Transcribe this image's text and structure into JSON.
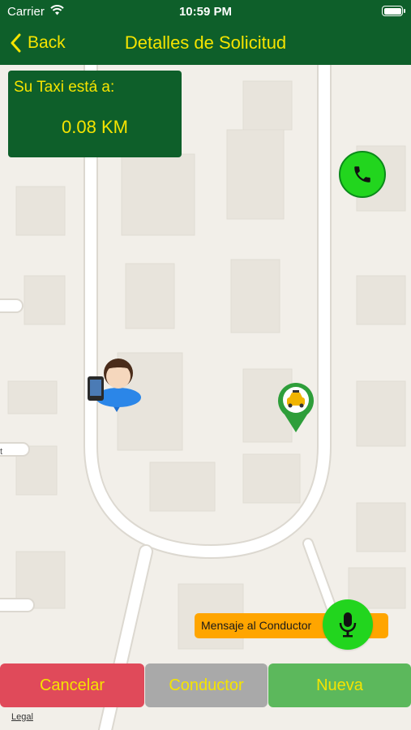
{
  "status_bar": {
    "carrier": "Carrier",
    "time": "10:59 PM"
  },
  "nav": {
    "back_label": "Back",
    "title": "Detalles de Solicitud"
  },
  "distance_card": {
    "label": "Su Taxi está a:",
    "value": "0.08 KM"
  },
  "message_bar": {
    "label": "Mensaje al Conductor"
  },
  "bottom_buttons": {
    "cancel": "Cancelar",
    "driver": "Conductor",
    "new": "Nueva"
  },
  "map": {
    "legal": "Legal",
    "street_fragment": "t"
  },
  "icons": {
    "back": "chevron-left-icon",
    "call": "phone-icon",
    "mic": "microphone-icon",
    "user_marker": "user-location-icon",
    "taxi_marker": "taxi-location-icon"
  },
  "colors": {
    "header": "#0e5f2a",
    "accent_text": "#f5e400",
    "call_green": "#22d51e",
    "message_orange": "#ffa500",
    "cancel_red": "#e04a5a",
    "driver_gray": "#a9a9a9",
    "new_green": "#5cb85c"
  }
}
